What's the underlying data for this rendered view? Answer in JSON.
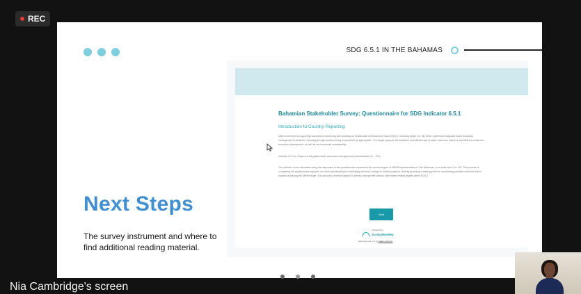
{
  "recording": {
    "label": "REC"
  },
  "slide": {
    "header_title": "SDG 6.5.1 IN THE BAHAMAS",
    "heading": "Next Steps",
    "description": "The survey instrument and where to find additional reading material.",
    "accent_color": "#7dcfe0",
    "heading_color": "#3f8fd2"
  },
  "survey": {
    "title": "Bahamian Stakeholder Survey: Questionnaire for SDG Indicator 6.5.1",
    "subtitle": "Introduction to Country Reporting",
    "paragraph1": "UN Environment is supporting countries in monitoring and reporting on Sustainable Development Goal (SDG) 6, including target 6.5: \"By 2030, implement integrated water resources management at all levels, including through transboundary cooperation as appropriate\". The target supports the equitable and efficient use of water resources, which is essential for social and economic development, as well as environmental sustainability.",
    "paragraph2": "Indicator 6.5.1 is: Degree of integrated water resources management implementation (0 – 100).",
    "paragraph3": "The indicator score calculated using the responses to this questionnaire represents the current degree of IWRM implementation in The Bahamas, on a scale from 0 to 100. The process of completing the questionnaire supports our local reporting team in identifying barriers or delays to further progress, thereby providing a starting point for considering possible corrective action towards achieving the IWRM target. The actions to achieve target 6.5 directly underpin the various other water-related targets within SDG 6.",
    "next_button": "Next",
    "powered_by": "Powered by",
    "brand": "SurveyMonkey",
    "footer_prefix": "See how easy it is to ",
    "footer_link": "create a survey.",
    "band_color": "#cfe9ee",
    "button_color": "#189aa8"
  },
  "presenter": {
    "screen_label": "Nia Cambridge's screen"
  }
}
